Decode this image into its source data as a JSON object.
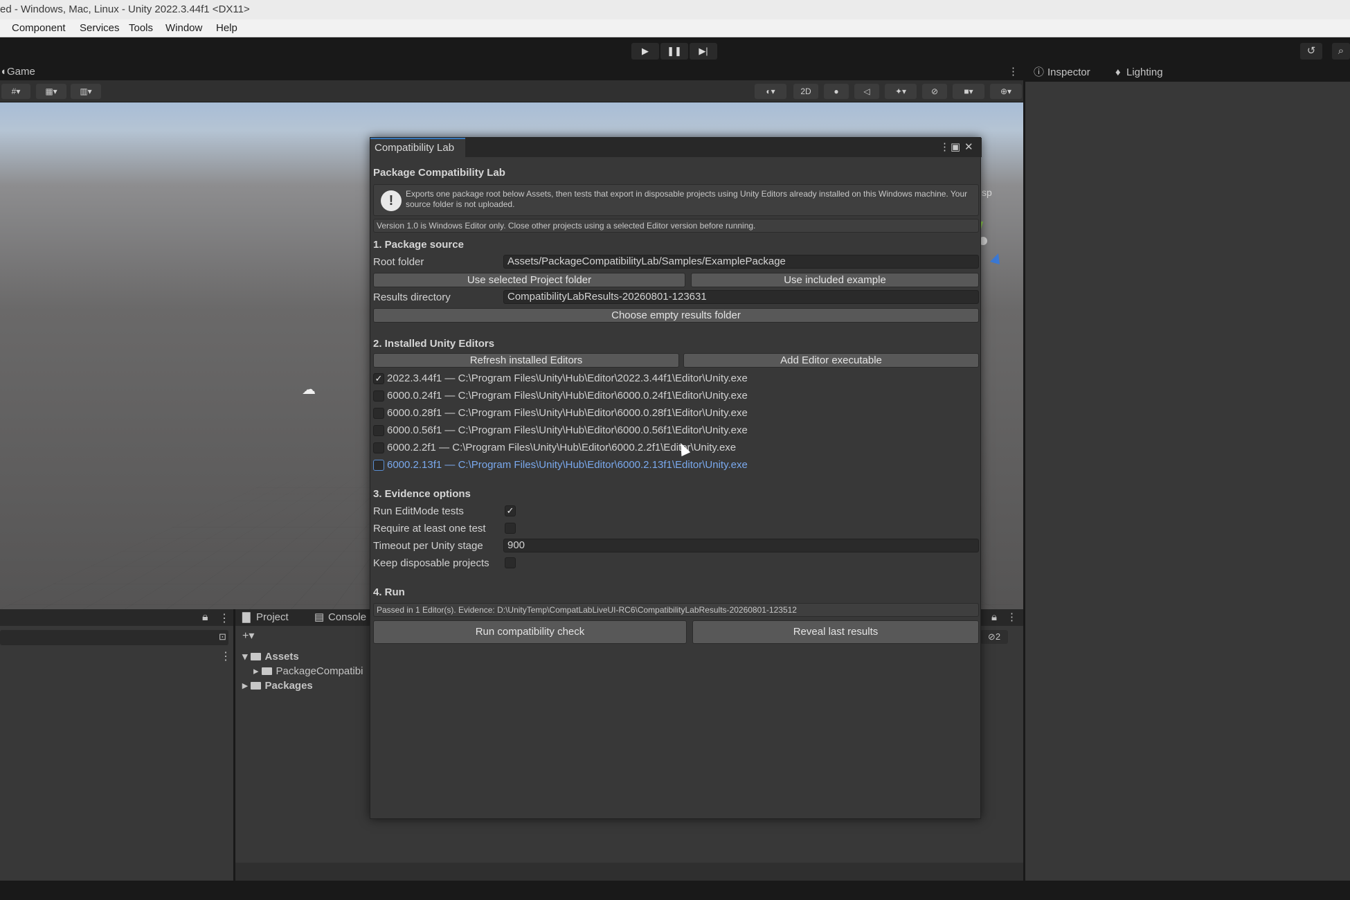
{
  "window": {
    "title": "ed - Windows, Mac, Linux - Unity 2022.3.44f1 <DX11>"
  },
  "menu": [
    "Component",
    "Services",
    "Tools",
    "Window",
    "Help"
  ],
  "toolbar": {
    "play_icon": "play-icon",
    "pause_icon": "pause-icon",
    "step_icon": "step-icon"
  },
  "scene": {
    "tab_label": "Game",
    "two_d_label": "2D",
    "side_text": "sp"
  },
  "inspector": {
    "tabs": [
      "Inspector",
      "Lighting"
    ]
  },
  "project": {
    "tabs": [
      "Project",
      "Console"
    ],
    "tree": [
      {
        "label": "Assets",
        "expanded": true
      },
      {
        "label": "PackageCompatibi",
        "expanded": false
      },
      {
        "label": "Packages",
        "expanded": false
      }
    ],
    "hidden_count": "2"
  },
  "dialog": {
    "tab_label": "Compatibility Lab",
    "heading": "Package Compatibility Lab",
    "help_text": "Exports one package root below Assets, then tests that export in disposable projects using Unity Editors already installed on this Windows machine. Your source folder is not uploaded.",
    "version_note": "Version 1.0 is Windows Editor only. Close other projects using a selected Editor version before running.",
    "section1": {
      "title": "1. Package source",
      "root_label": "Root folder",
      "root_value": "Assets/PackageCompatibilityLab/Samples/ExamplePackage",
      "use_selected": "Use selected Project folder",
      "use_example": "Use included example",
      "results_label": "Results directory",
      "results_value": "CompatibilityLabResults-20260801-123631",
      "choose_results": "Choose empty results folder"
    },
    "section2": {
      "title": "2. Installed Unity Editors",
      "refresh": "Refresh installed Editors",
      "add": "Add Editor executable",
      "editors": [
        {
          "label": "2022.3.44f1 — C:\\Program Files\\Unity\\Hub\\Editor\\2022.3.44f1\\Editor\\Unity.exe",
          "checked": true
        },
        {
          "label": "6000.0.24f1 — C:\\Program Files\\Unity\\Hub\\Editor\\6000.0.24f1\\Editor\\Unity.exe",
          "checked": false
        },
        {
          "label": "6000.0.28f1 — C:\\Program Files\\Unity\\Hub\\Editor\\6000.0.28f1\\Editor\\Unity.exe",
          "checked": false
        },
        {
          "label": "6000.0.56f1 — C:\\Program Files\\Unity\\Hub\\Editor\\6000.0.56f1\\Editor\\Unity.exe",
          "checked": false
        },
        {
          "label": "6000.2.2f1 — C:\\Program Files\\Unity\\Hub\\Editor\\6000.2.2f1\\Editor\\Unity.exe",
          "checked": false
        },
        {
          "label": "6000.2.13f1 — C:\\Program Files\\Unity\\Hub\\Editor\\6000.2.13f1\\Editor\\Unity.exe",
          "checked": false
        }
      ]
    },
    "section3": {
      "title": "3. Evidence options",
      "run_editmode": "Run EditMode tests",
      "run_editmode_checked": true,
      "require_test": "Require at least one test",
      "require_test_checked": false,
      "timeout_label": "Timeout per Unity stage",
      "timeout_value": "900",
      "keep_projects": "Keep disposable projects",
      "keep_projects_checked": false
    },
    "section4": {
      "title": "4. Run",
      "status": "Passed in 1 Editor(s). Evidence: D:\\UnityTemp\\CompatLabLiveUI-RC6\\CompatibilityLabResults-20260801-123512",
      "run": "Run compatibility check",
      "reveal": "Reveal last results"
    }
  }
}
